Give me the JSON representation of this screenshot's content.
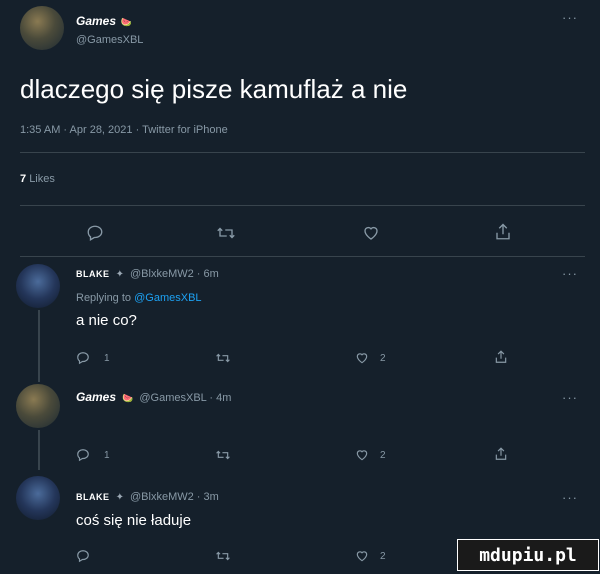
{
  "main_tweet": {
    "author_name": "Games",
    "author_badge": "🍉",
    "handle": "@GamesXBL",
    "text": "dlaczego się pisze kamuflaż a nie",
    "meta": "1:35 AM · Apr 28, 2021 · Twitter for iPhone",
    "likes_count": "7",
    "likes_label": "Likes",
    "more": "···"
  },
  "replies": [
    {
      "author_name": "BLAKE",
      "author_badge": "✦",
      "handle_time": "@BlxkeMW2 · 6m",
      "replying_prefix": "Replying to",
      "replying_handle": "@GamesXBL",
      "text": "a nie co?",
      "reply_count": "1",
      "like_count": "2",
      "more": "···"
    },
    {
      "author_name": "Games",
      "author_badge": "🍉",
      "handle_time": "@GamesXBL · 4m",
      "reply_count": "1",
      "like_count": "2",
      "more": "···"
    },
    {
      "author_name": "BLAKE",
      "author_badge": "✦",
      "handle_time": "@BlxkeMW2 · 3m",
      "text": "coś się nie ładuje",
      "like_count": "2",
      "more": "···"
    }
  ],
  "watermark": "mdupiu.pl",
  "icons": [
    "reply-icon",
    "retweet-icon",
    "like-icon",
    "share-icon"
  ]
}
